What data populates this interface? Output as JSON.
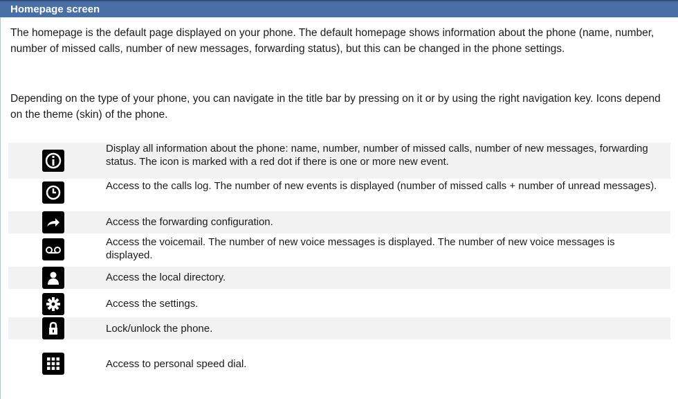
{
  "header": {
    "title": "Homepage screen"
  },
  "paragraphs": [
    "The homepage is the default page displayed on your phone. The default homepage shows information about the phone (name, number, number of missed calls, number of new messages, forwarding status), but this can be changed in the phone settings.",
    "Depending on the type of your phone, you can navigate in the title bar by pressing on it or by using the right navigation key. Icons depend on the theme (skin) of the phone."
  ],
  "rows": [
    {
      "icon": "info-icon",
      "text": "Display all information about the phone: name, number, number of missed calls, number of new messages, forwarding status. The icon is marked with a red dot if there is one or more new event."
    },
    {
      "icon": "clock-icon",
      "text": "Access to the calls log. The number of new events is displayed (number of missed calls + number of unread messages)."
    },
    {
      "icon": "forward-arrow-icon",
      "text": "Access the forwarding configuration."
    },
    {
      "icon": "voicemail-icon",
      "text": "Access the voicemail. The number of new voice messages is displayed. The number of new voice messages is displayed."
    },
    {
      "icon": "person-icon",
      "text": "Access the local directory."
    },
    {
      "icon": "gear-icon",
      "text": "Access the settings."
    },
    {
      "icon": "lock-icon",
      "text": "Lock/unlock the phone."
    },
    {
      "icon": "keypad-icon",
      "text": "Access to personal speed dial."
    }
  ]
}
